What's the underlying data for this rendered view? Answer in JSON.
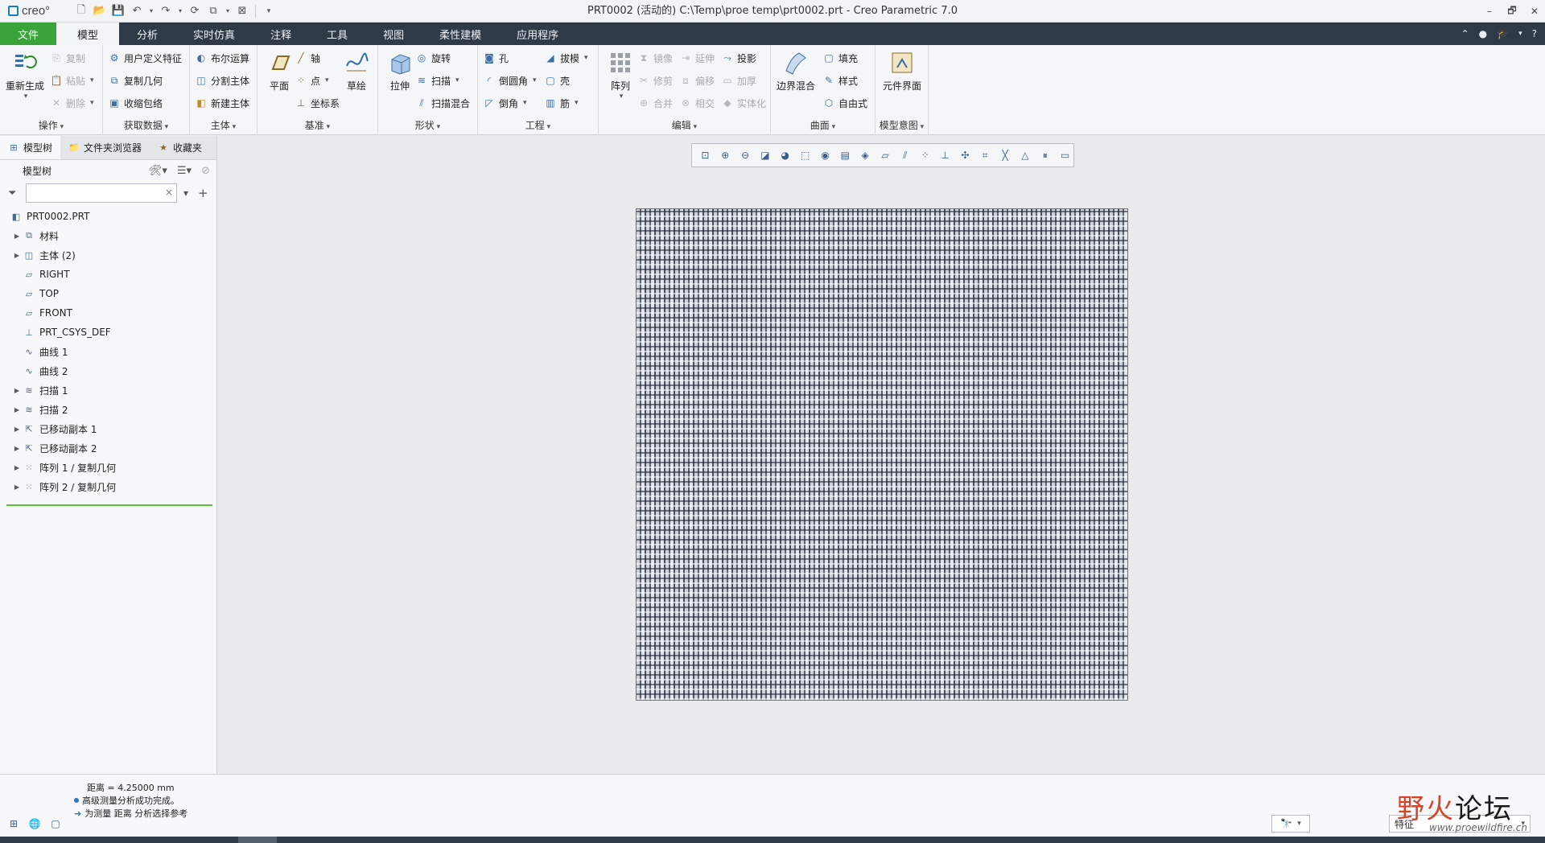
{
  "titlebar": {
    "logo_text": "creo°",
    "window_title": "PRT0002 (活动的) C:\\Temp\\proe temp\\prt0002.prt - Creo Parametric 7.0",
    "minimize": "–",
    "restore": "🗗",
    "close": "✕"
  },
  "tabs": [
    {
      "label": "文件"
    },
    {
      "label": "模型"
    },
    {
      "label": "分析"
    },
    {
      "label": "实时仿真"
    },
    {
      "label": "注释"
    },
    {
      "label": "工具"
    },
    {
      "label": "视图"
    },
    {
      "label": "柔性建模"
    },
    {
      "label": "应用程序"
    }
  ],
  "ribbon": {
    "groups": {
      "operations": {
        "label": "操作",
        "regen": "重新生成",
        "copy": "复制",
        "paste": "粘贴",
        "delete": "删除"
      },
      "get_data": {
        "label": "获取数据",
        "udf": "用户定义特征",
        "copy_geom": "复制几何",
        "shrinkwrap": "收缩包络"
      },
      "body": {
        "label": "主体",
        "boolean": "布尔运算",
        "split": "分割主体",
        "new_body": "新建主体"
      },
      "datum": {
        "label": "基准",
        "plane": "平面",
        "axis": "轴",
        "point": "点",
        "csys": "坐标系",
        "sketch": "草绘"
      },
      "shapes": {
        "label": "形状",
        "extrude": "拉伸",
        "revolve": "旋转",
        "sweep": "扫描",
        "swept_blend": "扫描混合"
      },
      "engineering": {
        "label": "工程",
        "hole": "孔",
        "draft": "拔模",
        "round": "倒圆角",
        "shell": "壳",
        "chamfer": "倒角",
        "rib": "筋"
      },
      "editing": {
        "label": "编辑",
        "pattern": "阵列",
        "mirror": "镜像",
        "extend": "延伸",
        "project": "投影",
        "trim": "修剪",
        "offset": "偏移",
        "thicken": "加厚",
        "merge": "合并",
        "intersect": "相交",
        "solidify": "实体化"
      },
      "surfaces": {
        "label": "曲面",
        "boundary_blend": "边界混合",
        "fill": "填充",
        "style": "样式",
        "freestyle": "自由式"
      },
      "model_intent": {
        "label": "模型意图",
        "component_interface": "元件界面"
      }
    }
  },
  "panel": {
    "tabs": [
      {
        "label": "模型树"
      },
      {
        "label": "文件夹浏览器"
      },
      {
        "label": "收藏夹"
      }
    ],
    "tree_header": "模型树",
    "search_placeholder": "",
    "search_clear": "×",
    "nodes": [
      {
        "label": "PRT0002.PRT",
        "icon": "part-icon",
        "expander": ""
      },
      {
        "label": "材料",
        "icon": "material-icon",
        "expander": "▶"
      },
      {
        "label": "主体 (2)",
        "icon": "body-icon",
        "expander": "▶"
      },
      {
        "label": "RIGHT",
        "icon": "datum-plane-icon",
        "expander": ""
      },
      {
        "label": "TOP",
        "icon": "datum-plane-icon",
        "expander": ""
      },
      {
        "label": "FRONT",
        "icon": "datum-plane-icon",
        "expander": ""
      },
      {
        "label": "PRT_CSYS_DEF",
        "icon": "csys-icon",
        "expander": ""
      },
      {
        "label": "曲线 1",
        "icon": "curve-icon",
        "expander": ""
      },
      {
        "label": "曲线 2",
        "icon": "curve-icon",
        "expander": ""
      },
      {
        "label": "扫描 1",
        "icon": "sweep-icon",
        "expander": "▶"
      },
      {
        "label": "扫描 2",
        "icon": "sweep-icon",
        "expander": "▶"
      },
      {
        "label": "已移动副本 1",
        "icon": "moved-copy-icon",
        "expander": "▶"
      },
      {
        "label": "已移动副本 2",
        "icon": "moved-copy-icon",
        "expander": "▶"
      },
      {
        "label": "阵列 1 / 复制几何",
        "icon": "pattern-icon",
        "expander": "▶"
      },
      {
        "label": "阵列 2 / 复制几何",
        "icon": "pattern-icon",
        "expander": "▶"
      }
    ]
  },
  "status": {
    "messages": [
      "距离 = 4.25000 mm",
      "高级测量分析成功完成。",
      "为测量 距离 分析选择参考"
    ],
    "selection_filter": "特征"
  },
  "watermark": {
    "text_colored": "野火",
    "text_black": "论坛",
    "url": "www.proewildfire.cn"
  },
  "colors": {
    "file_tab": "#3aa43a",
    "tabs_bar": "#2f3a46",
    "tree_end_line": "#5cbf3c",
    "watermark": "#d8442a"
  }
}
